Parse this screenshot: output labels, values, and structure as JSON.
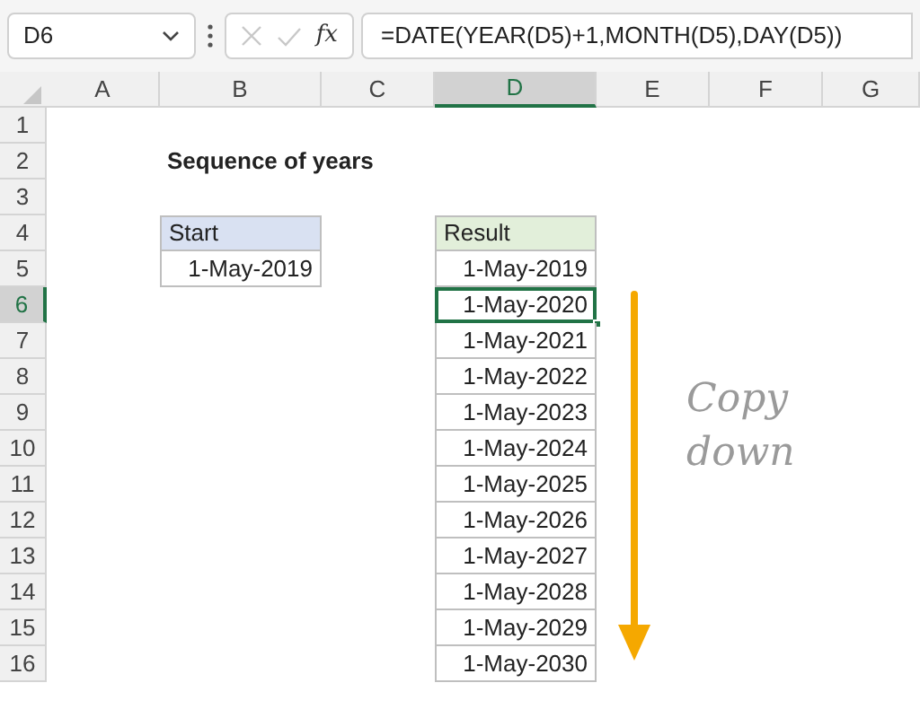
{
  "name_box": {
    "value": "D6"
  },
  "formula_bar": {
    "fx_label": "fx",
    "formula": "=DATE(YEAR(D5)+1,MONTH(D5),DAY(D5))"
  },
  "columns": [
    {
      "label": "A",
      "selected": false
    },
    {
      "label": "B",
      "selected": false
    },
    {
      "label": "C",
      "selected": false
    },
    {
      "label": "D",
      "selected": true
    },
    {
      "label": "E",
      "selected": false
    },
    {
      "label": "F",
      "selected": false
    },
    {
      "label": "G",
      "selected": false
    }
  ],
  "rows": [
    {
      "label": "1",
      "selected": false
    },
    {
      "label": "2",
      "selected": false
    },
    {
      "label": "3",
      "selected": false
    },
    {
      "label": "4",
      "selected": false
    },
    {
      "label": "5",
      "selected": false
    },
    {
      "label": "6",
      "selected": true
    },
    {
      "label": "7",
      "selected": false
    },
    {
      "label": "8",
      "selected": false
    },
    {
      "label": "9",
      "selected": false
    },
    {
      "label": "10",
      "selected": false
    },
    {
      "label": "11",
      "selected": false
    },
    {
      "label": "12",
      "selected": false
    },
    {
      "label": "13",
      "selected": false
    },
    {
      "label": "14",
      "selected": false
    },
    {
      "label": "15",
      "selected": false
    },
    {
      "label": "16",
      "selected": false
    }
  ],
  "title": "Sequence of years",
  "start_table": {
    "header": "Start",
    "values": [
      "1-May-2019"
    ]
  },
  "result_table": {
    "header": "Result",
    "values": [
      {
        "text": "1-May-2019",
        "selected": false
      },
      {
        "text": "1-May-2020",
        "selected": true
      },
      {
        "text": "1-May-2021",
        "selected": false
      },
      {
        "text": "1-May-2022",
        "selected": false
      },
      {
        "text": "1-May-2023",
        "selected": false
      },
      {
        "text": "1-May-2024",
        "selected": false
      },
      {
        "text": "1-May-2025",
        "selected": false
      },
      {
        "text": "1-May-2026",
        "selected": false
      },
      {
        "text": "1-May-2027",
        "selected": false
      },
      {
        "text": "1-May-2028",
        "selected": false
      },
      {
        "text": "1-May-2029",
        "selected": false
      },
      {
        "text": "1-May-2030",
        "selected": false
      }
    ]
  },
  "annotation": {
    "lines": [
      "Copy",
      "down"
    ]
  }
}
